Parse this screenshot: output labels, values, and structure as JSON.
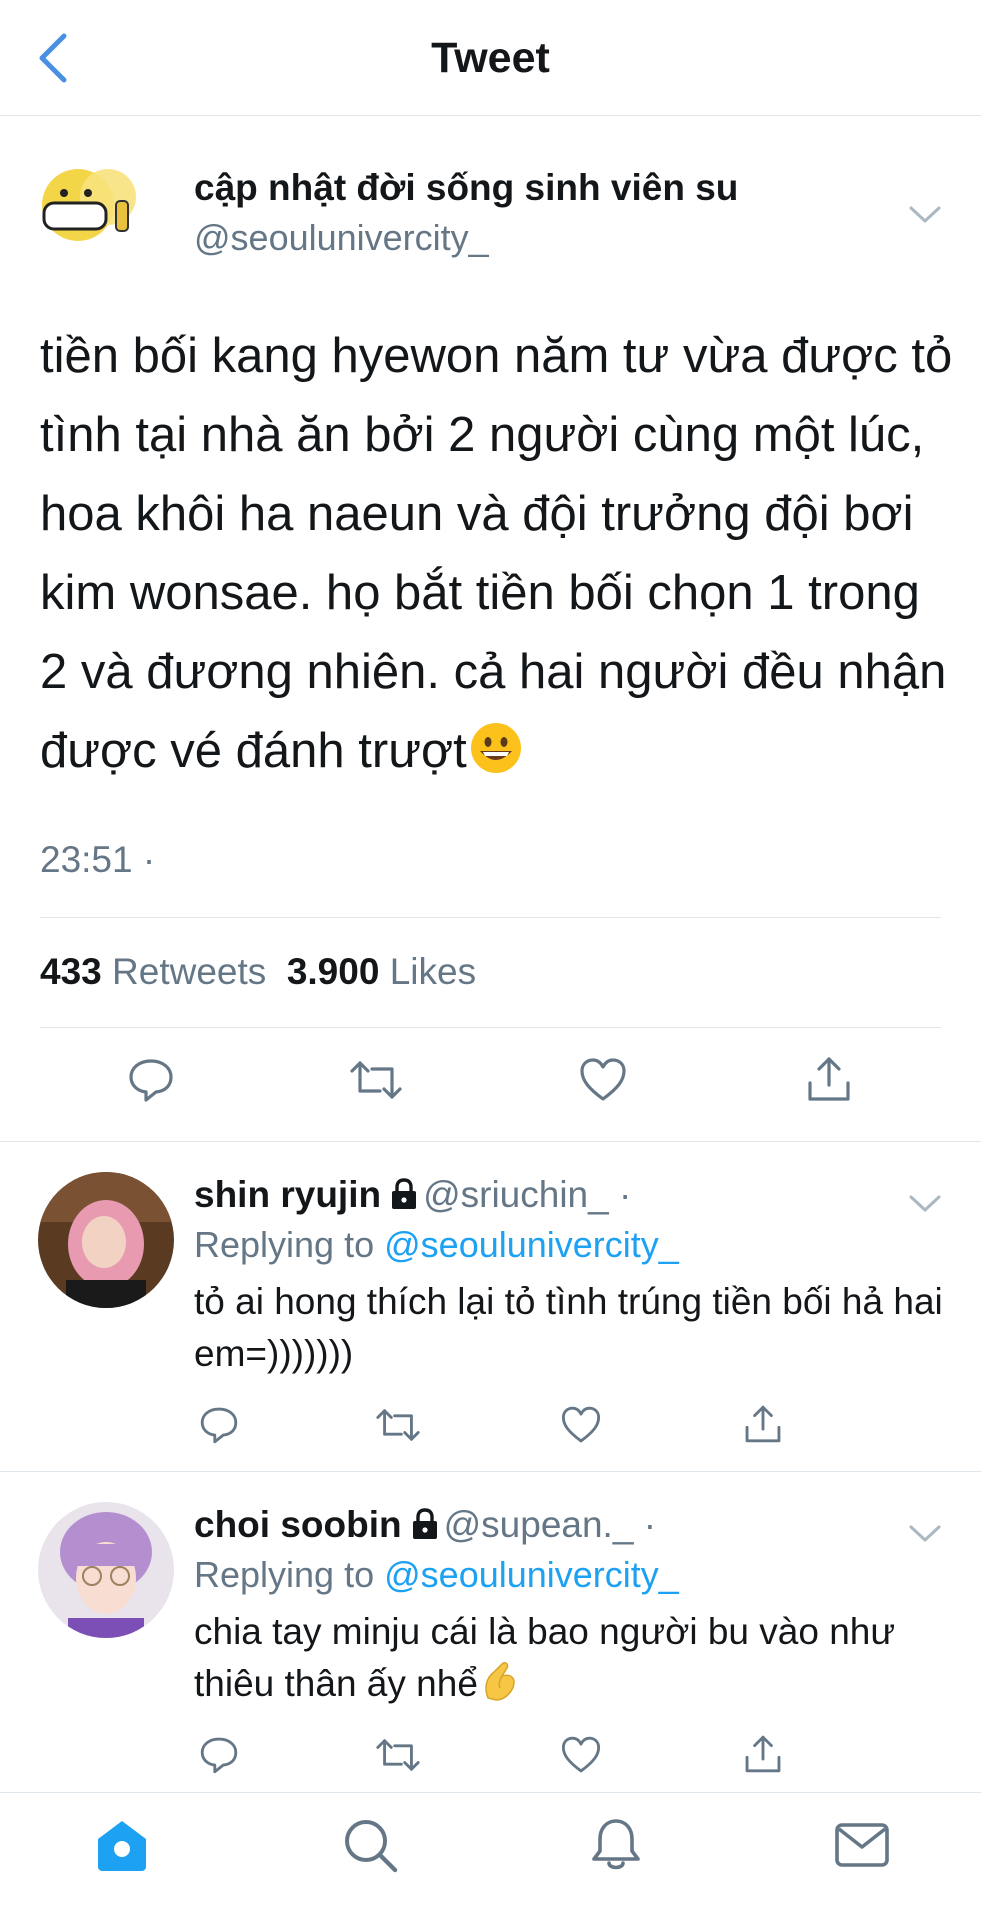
{
  "header": {
    "title": "Tweet"
  },
  "tweet": {
    "author_name": "cập nhật đời sống sinh viên su",
    "author_handle": "@seouluniverc​ity_",
    "text": "tiền bối kang hyewon năm tư vừa được tỏ tình tại nhà ăn bởi 2 người cùng một lúc, hoa khôi ha naeun và đội trưởng đội bơi kim wonsae. họ bắt tiền bối chọn 1 trong 2 và đương nhiên. cả hai người đều nhận được vé đánh trượt",
    "text_emoji": "grinning-face-emoji",
    "time": "23:51 ·",
    "retweets_count": "433",
    "retweets_label": "Retweets",
    "likes_count": "3.900",
    "likes_label": "Likes"
  },
  "replies": [
    {
      "name": "shin ryujin",
      "handle": "@sriuchin_ ·",
      "replying_prefix": "Replying to",
      "replying_to": "@seouluniverc​ity_",
      "text": "tỏ ai hong thích lại tỏ tình trúng tiền bối hả hai em=)))))))"
    },
    {
      "name": "choi soobin",
      "handle": "@supean._ ·",
      "replying_prefix": "Replying to",
      "replying_to": "@seouluniverc​ity_",
      "text": "chia tay minju cái là bao người bu vào như thiêu thân ấy nhể",
      "text_emoji": "pinching-hand-emoji"
    }
  ],
  "icons": {
    "back": "chevron-left-icon",
    "caret": "chevron-down-icon",
    "lock": "lock-icon",
    "reply": "reply-icon",
    "retweet": "retweet-icon",
    "like": "heart-icon",
    "share": "share-icon",
    "home": "home-icon",
    "search": "search-icon",
    "notifications": "bell-icon",
    "messages": "mail-icon"
  },
  "colors": {
    "accent": "#1da1f2",
    "back": "#4a90e2",
    "secondary_text": "#657786",
    "divider": "#e1e8ed"
  }
}
